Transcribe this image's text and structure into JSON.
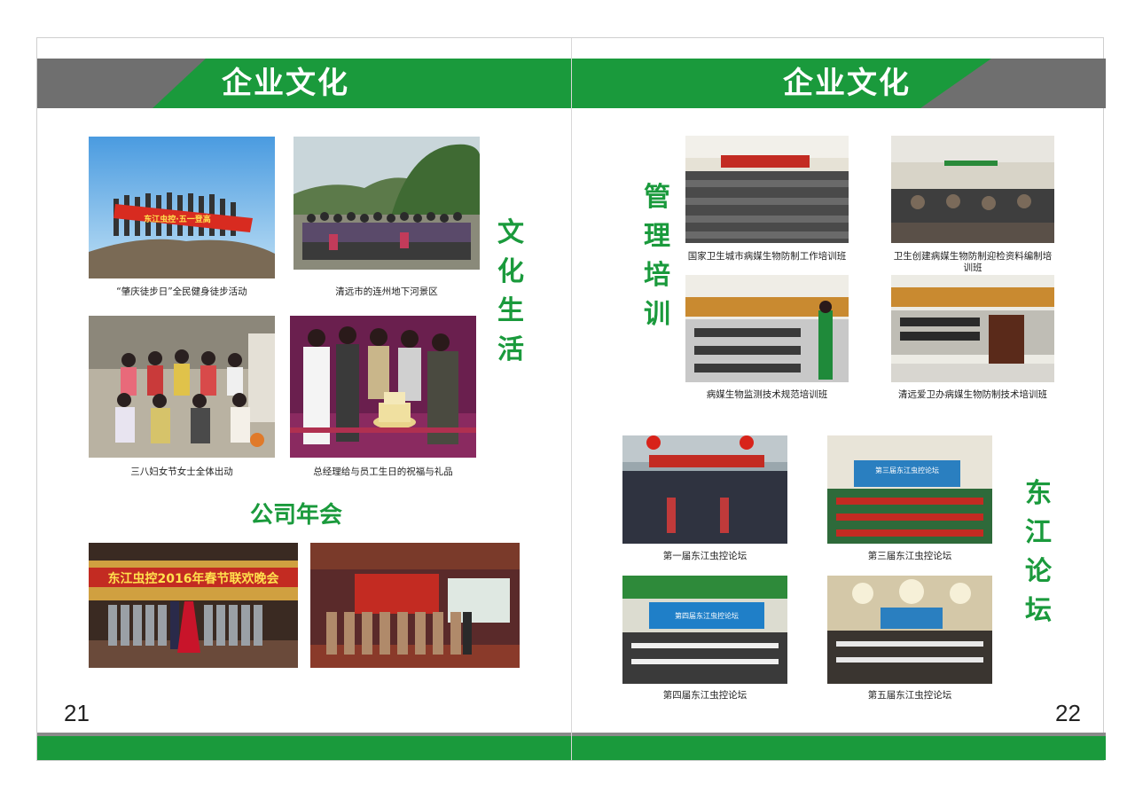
{
  "left_page": {
    "header_title": "企业文化",
    "section_culture_life": "文化生活",
    "section_annual_meeting": "公司年会",
    "captions": [
      "“肇庆徒步日”全民健身徒步活动",
      "清远市的连州地下河景区",
      "三八妇女节女士全体出动",
      "总经理给与员工生日的祝福与礼品"
    ],
    "photo_texts": {
      "hike_banner": "东江虫控·五一登高",
      "gala_banner": "东江虫控2016年春节联欢晚会"
    },
    "page_number": "21"
  },
  "right_page": {
    "header_title": "企业文化",
    "section_management_training": "管理培训",
    "section_dongjiang_forum": "东江论坛",
    "training_captions": [
      "国家卫生城市病媒生物防制工作培训班",
      "卫生创建病媒生物防制迎检资料编制培训班",
      "病媒生物监测技术规范培训班",
      "清远爱卫办病媒生物防制技术培训班"
    ],
    "forum_captions": [
      "第一届东江虫控论坛",
      "第三届东江虫控论坛",
      "第四届东江虫控论坛",
      "第五届东江虫控论坛"
    ],
    "photo_texts": {
      "forum3_screen": "第三届东江虫控论坛",
      "forum4_screen": "第四届东江虫控论坛"
    },
    "page_number": "22"
  },
  "colors": {
    "green": "#1a9a3c",
    "gray": "#6f6f6f"
  }
}
